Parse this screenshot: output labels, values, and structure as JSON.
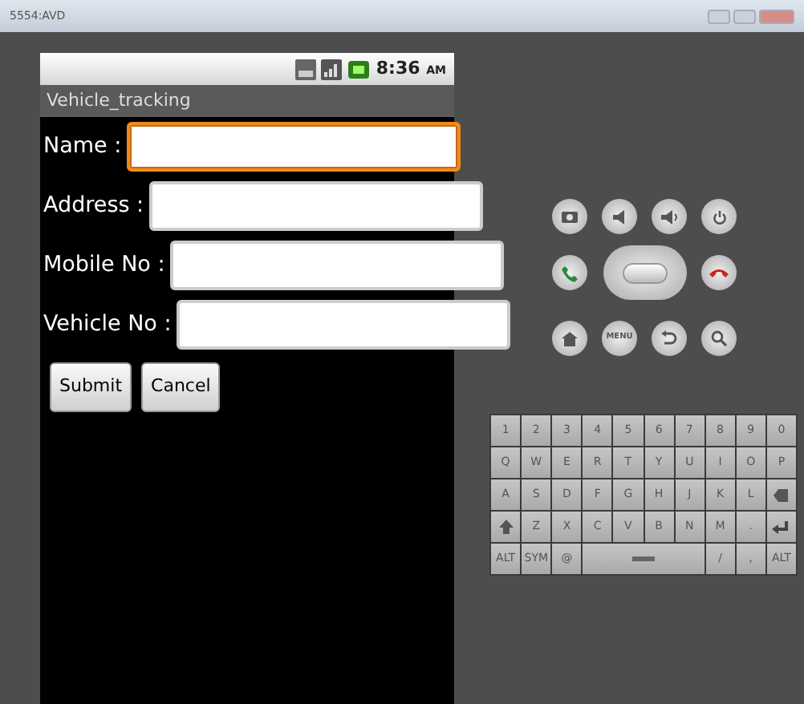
{
  "window": {
    "title": "5554:AVD"
  },
  "status_bar": {
    "time": "8:36",
    "meridiem": "AM"
  },
  "app": {
    "title": "Vehicle_tracking",
    "fields": [
      {
        "label": "Name :",
        "focused": true
      },
      {
        "label": "Address :",
        "focused": false
      },
      {
        "label": "Mobile No :",
        "focused": false
      },
      {
        "label": "Vehicle No :",
        "focused": false
      }
    ],
    "buttons": [
      "Submit",
      "Cancel"
    ]
  },
  "emulator_controls": {
    "menu_label": "MENU"
  },
  "keyboard": {
    "rows": [
      [
        {
          "kind": "char",
          "label": "1"
        },
        {
          "kind": "char",
          "label": "2"
        },
        {
          "kind": "char",
          "label": "3"
        },
        {
          "kind": "char",
          "label": "4"
        },
        {
          "kind": "char",
          "label": "5"
        },
        {
          "kind": "char",
          "label": "6"
        },
        {
          "kind": "char",
          "label": "7"
        },
        {
          "kind": "char",
          "label": "8"
        },
        {
          "kind": "char",
          "label": "9"
        },
        {
          "kind": "char",
          "label": "0"
        }
      ],
      [
        {
          "kind": "char",
          "label": "Q"
        },
        {
          "kind": "char",
          "label": "W"
        },
        {
          "kind": "char",
          "label": "E"
        },
        {
          "kind": "char",
          "label": "R"
        },
        {
          "kind": "char",
          "label": "T"
        },
        {
          "kind": "char",
          "label": "Y"
        },
        {
          "kind": "char",
          "label": "U"
        },
        {
          "kind": "char",
          "label": "I"
        },
        {
          "kind": "char",
          "label": "O"
        },
        {
          "kind": "char",
          "label": "P"
        }
      ],
      [
        {
          "kind": "char",
          "label": "A"
        },
        {
          "kind": "char",
          "label": "S"
        },
        {
          "kind": "char",
          "label": "D"
        },
        {
          "kind": "char",
          "label": "F"
        },
        {
          "kind": "char",
          "label": "G"
        },
        {
          "kind": "char",
          "label": "H"
        },
        {
          "kind": "char",
          "label": "J"
        },
        {
          "kind": "char",
          "label": "K"
        },
        {
          "kind": "char",
          "label": "L"
        },
        {
          "kind": "del"
        }
      ],
      [
        {
          "kind": "shift"
        },
        {
          "kind": "char",
          "label": "Z"
        },
        {
          "kind": "char",
          "label": "X"
        },
        {
          "kind": "char",
          "label": "C"
        },
        {
          "kind": "char",
          "label": "V"
        },
        {
          "kind": "char",
          "label": "B"
        },
        {
          "kind": "char",
          "label": "N"
        },
        {
          "kind": "char",
          "label": "M"
        },
        {
          "kind": "char",
          "label": "."
        },
        {
          "kind": "enter"
        }
      ],
      [
        {
          "kind": "char",
          "label": "ALT"
        },
        {
          "kind": "char",
          "label": "SYM"
        },
        {
          "kind": "char",
          "label": "@"
        },
        {
          "kind": "space",
          "colspan": 4
        },
        {
          "kind": "char",
          "label": "/"
        },
        {
          "kind": "char",
          "label": ","
        },
        {
          "kind": "char",
          "label": "ALT"
        }
      ]
    ]
  }
}
